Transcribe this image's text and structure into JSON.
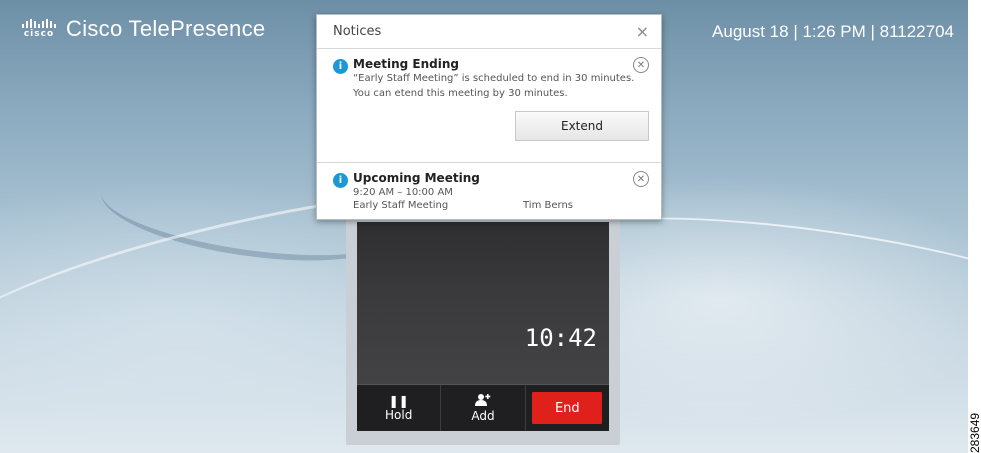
{
  "brand": {
    "logo_text": "cisco",
    "name": "Cisco TelePresence"
  },
  "status": {
    "text": "August 18 | 1:26 PM | 81122704"
  },
  "notices": {
    "title": "Notices",
    "close_glyph": "×",
    "items": [
      {
        "title": "Meeting Ending",
        "line1": "“Early Staff Meeting” is scheduled to end in 30 minutes.",
        "line2": "You can etend this meeting by 30 minutes.",
        "action_label": "Extend"
      },
      {
        "title": "Upcoming Meeting",
        "time": "9:20 AM – 10:00 AM",
        "meeting_name": "Early Staff Meeting",
        "organizer": "Tim Berns"
      }
    ]
  },
  "call": {
    "timer": "10:42",
    "controls": {
      "hold_label": "Hold",
      "add_label": "Add",
      "end_label": "End"
    },
    "end_color": "#e0211b"
  },
  "figure_code": "283649",
  "colors": {
    "info_blue": "#1d98d6",
    "end_red": "#e0211b"
  }
}
